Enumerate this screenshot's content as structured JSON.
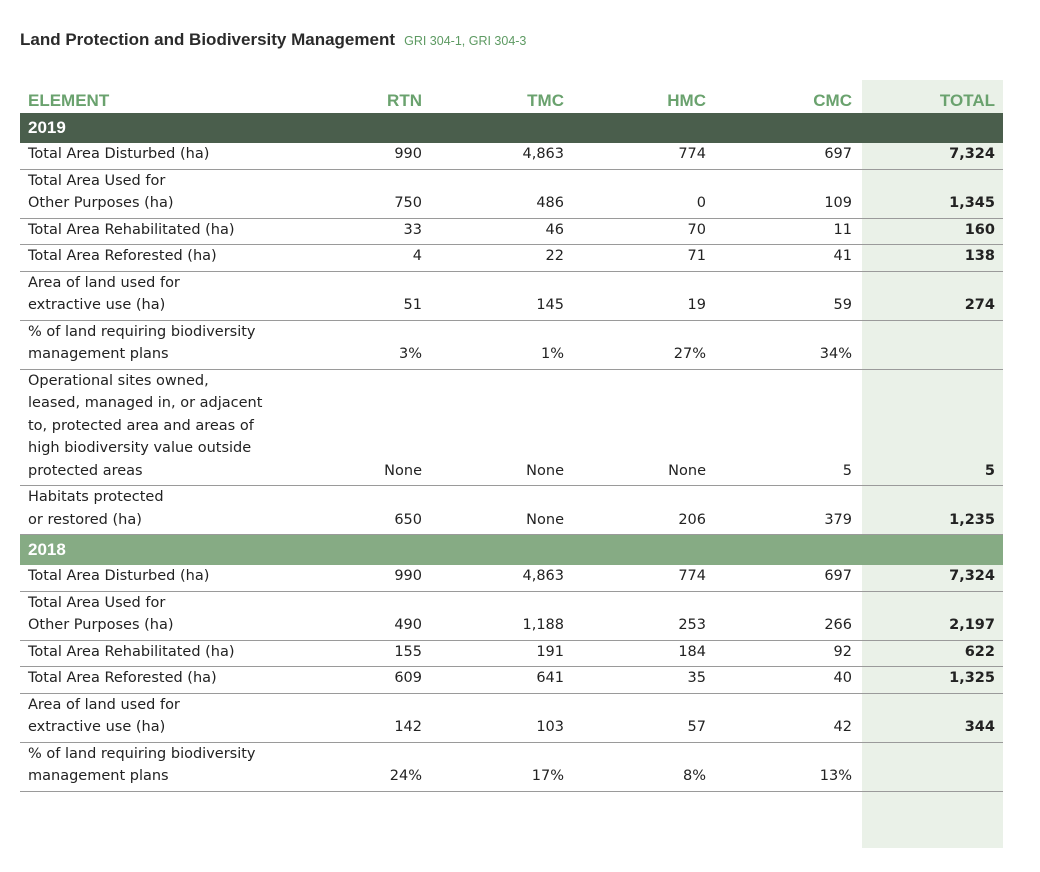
{
  "title": "Land Protection and Biodiversity Management",
  "subtitle": "GRI 304-1, GRI 304-3",
  "headers": [
    "ELEMENT",
    "RTN",
    "TMC",
    "HMC",
    "CMC",
    "TOTAL"
  ],
  "sections": [
    {
      "year": "2019",
      "rows": [
        {
          "label": "Total Area Disturbed (ha)",
          "values": [
            "990",
            "4,863",
            "774",
            "697",
            "7,324"
          ]
        },
        {
          "label": "Total Area Used for\nOther Purposes (ha)",
          "values": [
            "750",
            "486",
            "0",
            "109",
            "1,345"
          ]
        },
        {
          "label": "Total Area Rehabilitated (ha)",
          "values": [
            "33",
            "46",
            "70",
            "11",
            "160"
          ]
        },
        {
          "label": "Total Area Reforested (ha)",
          "values": [
            "4",
            "22",
            "71",
            "41",
            "138"
          ]
        },
        {
          "label": "Area of land used for\nextractive use (ha)",
          "values": [
            "51",
            "145",
            "19",
            "59",
            "274"
          ]
        },
        {
          "label": "% of land requiring biodiversity\nmanagement plans",
          "values": [
            "3%",
            "1%",
            "27%",
            "34%",
            ""
          ]
        },
        {
          "label": "Operational sites owned,\nleased, managed in, or adjacent\nto, protected area and areas of\nhigh biodiversity value outside\nprotected areas",
          "values": [
            "None",
            "None",
            "None",
            "5",
            "5"
          ]
        },
        {
          "label": "Habitats protected\nor restored (ha)",
          "values": [
            "650",
            "None",
            "206",
            "379",
            "1,235"
          ]
        }
      ]
    },
    {
      "year": "2018",
      "rows": [
        {
          "label": "Total Area Disturbed (ha)",
          "values": [
            "990",
            "4,863",
            "774",
            "697",
            "7,324"
          ]
        },
        {
          "label": "Total Area Used for\nOther Purposes (ha)",
          "values": [
            "490",
            "1,188",
            "253",
            "266",
            "2,197"
          ]
        },
        {
          "label": "Total Area Rehabilitated (ha)",
          "values": [
            "155",
            "191",
            "184",
            "92",
            "622"
          ]
        },
        {
          "label": "Total Area Reforested (ha)",
          "values": [
            "609",
            "641",
            "35",
            "40",
            "1,325"
          ]
        },
        {
          "label": "Area of land used for\nextractive use (ha)",
          "values": [
            "142",
            "103",
            "57",
            "42",
            "344"
          ]
        },
        {
          "label": "% of land requiring biodiversity\nmanagement plans",
          "values": [
            "24%",
            "17%",
            "8%",
            "13%",
            ""
          ]
        }
      ]
    }
  ],
  "colors": {
    "header_text": "#6aa26e",
    "year_2019_bg": "#4a5e4c",
    "year_2018_bg": "#86ab84",
    "total_column_bg": "#eaf1e8"
  }
}
